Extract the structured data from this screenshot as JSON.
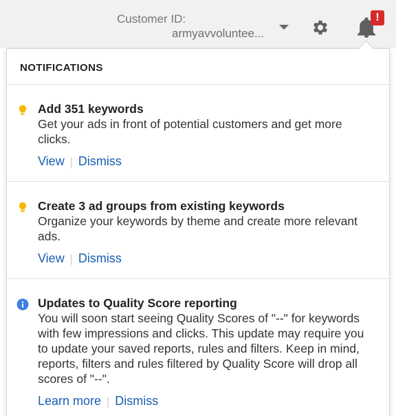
{
  "account": {
    "customer_id_label": "Customer ID:",
    "customer_id_value": "armyavvoluntee..."
  },
  "toolbar": {
    "settings_icon": "gear-icon",
    "notifications_icon": "bell-icon",
    "alert_badge": "!",
    "alert_color": "#d72b2b"
  },
  "panel": {
    "heading": "NOTIFICATIONS",
    "link_color": "#1a5fb4",
    "notifications": [
      {
        "icon": "lightbulb-icon",
        "title": "Add 351 keywords",
        "body": "Get your ads in front of potential customers and get more clicks.",
        "primary_action": "View",
        "secondary_action": "Dismiss"
      },
      {
        "icon": "lightbulb-icon",
        "title": "Create 3 ad groups from existing keywords",
        "body": "Organize your keywords by theme and create more relevant ads.",
        "primary_action": "View",
        "secondary_action": "Dismiss"
      },
      {
        "icon": "info-icon",
        "title": "Updates to Quality Score reporting",
        "body": "You will soon start seeing Quality Scores of \"--\" for keywords with few impressions and clicks. This update may require you to update your saved reports, rules and filters. Keep in mind, reports, filters and rules filtered by Quality Score will drop all scores of \"--\".",
        "primary_action": "Learn more",
        "secondary_action": "Dismiss"
      }
    ]
  }
}
